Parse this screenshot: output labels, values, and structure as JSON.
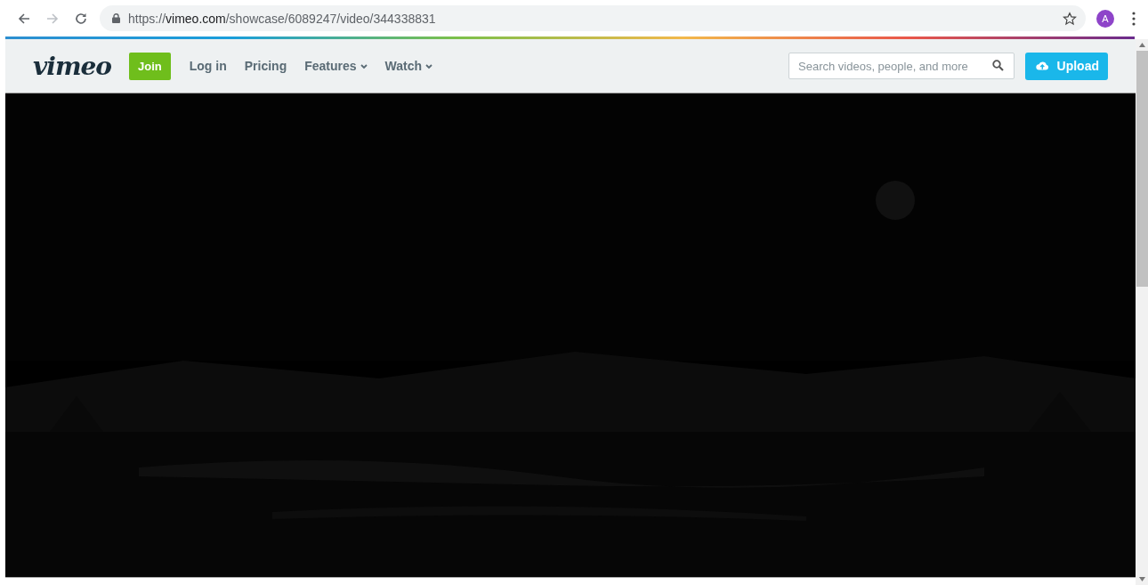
{
  "browser": {
    "url": {
      "scheme": "https://",
      "host": "vimeo.com",
      "path": "/showcase/6089247/video/344338831"
    },
    "avatar": "A",
    "forward_disabled": true
  },
  "nav": {
    "logo": "vimeo",
    "join": "Join",
    "links": [
      {
        "label": "Log in",
        "kind": "link"
      },
      {
        "label": "Pricing",
        "kind": "link"
      },
      {
        "label": "Features",
        "kind": "menu"
      },
      {
        "label": "Watch",
        "kind": "menu"
      }
    ],
    "search": {
      "placeholder": "Search videos, people, and more"
    },
    "upload": "Upload"
  }
}
